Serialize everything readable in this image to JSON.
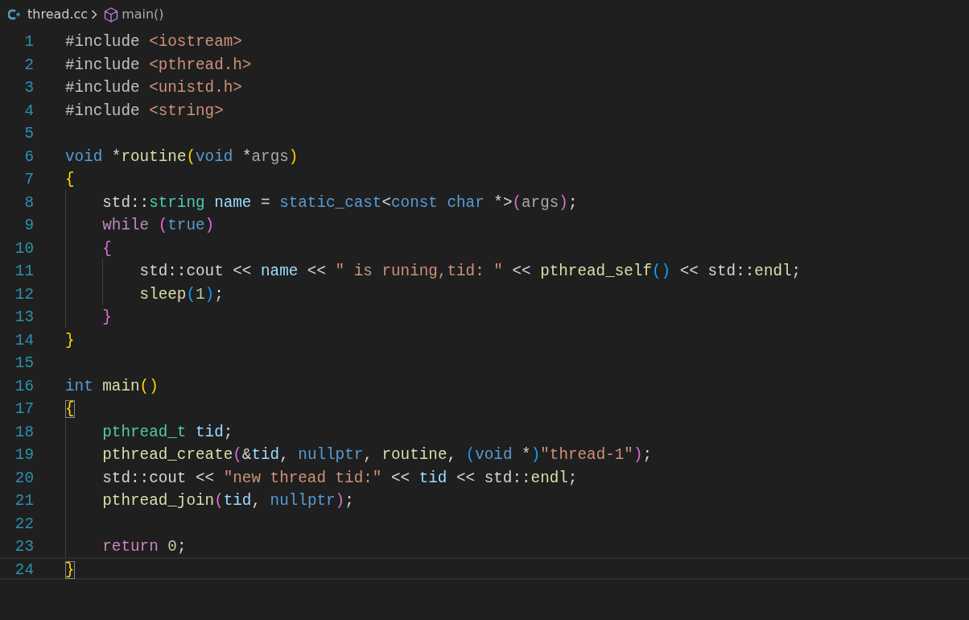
{
  "breadcrumb": {
    "file": "thread.cc",
    "symbol": "main()"
  },
  "lines": [
    {
      "number": "1",
      "tokens": [
        {
          "text": "#include ",
          "kind": "directive"
        },
        {
          "text": "<iostream>",
          "kind": "string"
        }
      ]
    },
    {
      "number": "2",
      "tokens": [
        {
          "text": "#include ",
          "kind": "directive"
        },
        {
          "text": "<pthread.h>",
          "kind": "string"
        }
      ]
    },
    {
      "number": "3",
      "tokens": [
        {
          "text": "#include ",
          "kind": "directive"
        },
        {
          "text": "<unistd.h>",
          "kind": "string"
        }
      ]
    },
    {
      "number": "4",
      "tokens": [
        {
          "text": "#include ",
          "kind": "directive"
        },
        {
          "text": "<string>",
          "kind": "string"
        }
      ]
    },
    {
      "number": "5"
    },
    {
      "number": "6",
      "tokens": [
        {
          "text": "void",
          "kind": "keyword"
        },
        {
          "text": " *",
          "kind": "plain"
        },
        {
          "text": "routine",
          "kind": "function"
        },
        {
          "text": "(",
          "kind": "bracket1"
        },
        {
          "text": "void",
          "kind": "keyword"
        },
        {
          "text": " *",
          "kind": "plain"
        },
        {
          "text": "args",
          "kind": "param"
        },
        {
          "text": ")",
          "kind": "bracket1"
        }
      ]
    },
    {
      "number": "7",
      "tokens": [
        {
          "text": "{",
          "kind": "bracket1"
        }
      ]
    },
    {
      "number": "8",
      "tokens": [
        {
          "text": "    std::",
          "kind": "plain"
        },
        {
          "text": "string",
          "kind": "type"
        },
        {
          "text": " name",
          "kind": "variable"
        },
        {
          "text": " = ",
          "kind": "plain"
        },
        {
          "text": "static_cast",
          "kind": "keyword"
        },
        {
          "text": "<",
          "kind": "plain"
        },
        {
          "text": "const char",
          "kind": "keyword"
        },
        {
          "text": " *>",
          "kind": "plain"
        },
        {
          "text": "(",
          "kind": "bracket2"
        },
        {
          "text": "args",
          "kind": "param"
        },
        {
          "text": ")",
          "kind": "bracket2"
        },
        {
          "text": ";",
          "kind": "plain"
        }
      ]
    },
    {
      "number": "9",
      "tokens": [
        {
          "text": "    while",
          "kind": "control"
        },
        {
          "text": " (",
          "kind": "bracket2"
        },
        {
          "text": "true",
          "kind": "keyword"
        },
        {
          "text": ")",
          "kind": "bracket2"
        }
      ]
    },
    {
      "number": "10",
      "tokens": [
        {
          "text": "    {",
          "kind": "bracket2"
        }
      ]
    },
    {
      "number": "11",
      "tokens": [
        {
          "text": "        std::cout << ",
          "kind": "plain"
        },
        {
          "text": "name",
          "kind": "variable"
        },
        {
          "text": " << ",
          "kind": "plain"
        },
        {
          "text": "\" is runing,tid: \"",
          "kind": "string"
        },
        {
          "text": " << ",
          "kind": "plain"
        },
        {
          "text": "pthread_self",
          "kind": "function"
        },
        {
          "text": "()",
          "kind": "bracket3"
        },
        {
          "text": " << std::",
          "kind": "plain"
        },
        {
          "text": "endl",
          "kind": "function"
        },
        {
          "text": ";",
          "kind": "plain"
        }
      ]
    },
    {
      "number": "12",
      "tokens": [
        {
          "text": "        sleep",
          "kind": "function"
        },
        {
          "text": "(",
          "kind": "bracket3"
        },
        {
          "text": "1",
          "kind": "number"
        },
        {
          "text": ")",
          "kind": "bracket3"
        },
        {
          "text": ";",
          "kind": "plain"
        }
      ]
    },
    {
      "number": "13",
      "tokens": [
        {
          "text": "    }",
          "kind": "bracket2"
        }
      ]
    },
    {
      "number": "14",
      "tokens": [
        {
          "text": "}",
          "kind": "bracket1"
        }
      ]
    },
    {
      "number": "15"
    },
    {
      "number": "16",
      "tokens": [
        {
          "text": "int",
          "kind": "keyword"
        },
        {
          "text": " main",
          "kind": "function"
        },
        {
          "text": "()",
          "kind": "bracket1"
        }
      ]
    },
    {
      "number": "17",
      "tokens": [
        {
          "text": "{",
          "kind": "bracket1",
          "matched": true
        }
      ]
    },
    {
      "number": "18",
      "tokens": [
        {
          "text": "    pthread_t",
          "kind": "type"
        },
        {
          "text": " tid",
          "kind": "variable"
        },
        {
          "text": ";",
          "kind": "plain"
        }
      ]
    },
    {
      "number": "19",
      "tokens": [
        {
          "text": "    pthread_create",
          "kind": "function"
        },
        {
          "text": "(",
          "kind": "bracket2"
        },
        {
          "text": "&",
          "kind": "plain"
        },
        {
          "text": "tid",
          "kind": "variable"
        },
        {
          "text": ", ",
          "kind": "plain"
        },
        {
          "text": "nullptr",
          "kind": "keyword"
        },
        {
          "text": ", ",
          "kind": "plain"
        },
        {
          "text": "routine",
          "kind": "function"
        },
        {
          "text": ", ",
          "kind": "plain"
        },
        {
          "text": "(",
          "kind": "bracket3"
        },
        {
          "text": "void",
          "kind": "keyword"
        },
        {
          "text": " *",
          "kind": "plain"
        },
        {
          "text": ")",
          "kind": "bracket3"
        },
        {
          "text": "\"thread-1\"",
          "kind": "string"
        },
        {
          "text": ")",
          "kind": "bracket2"
        },
        {
          "text": ";",
          "kind": "plain"
        }
      ]
    },
    {
      "number": "20",
      "tokens": [
        {
          "text": "    std::cout << ",
          "kind": "plain"
        },
        {
          "text": "\"new thread tid:\"",
          "kind": "string"
        },
        {
          "text": " << ",
          "kind": "plain"
        },
        {
          "text": "tid",
          "kind": "variable"
        },
        {
          "text": " << std::",
          "kind": "plain"
        },
        {
          "text": "endl",
          "kind": "function"
        },
        {
          "text": ";",
          "kind": "plain"
        }
      ]
    },
    {
      "number": "21",
      "tokens": [
        {
          "text": "    pthread_join",
          "kind": "function"
        },
        {
          "text": "(",
          "kind": "bracket2"
        },
        {
          "text": "tid",
          "kind": "variable"
        },
        {
          "text": ", ",
          "kind": "plain"
        },
        {
          "text": "nullptr",
          "kind": "keyword"
        },
        {
          "text": ")",
          "kind": "bracket2"
        },
        {
          "text": ";",
          "kind": "plain"
        }
      ]
    },
    {
      "number": "22"
    },
    {
      "number": "23",
      "tokens": [
        {
          "text": "    return",
          "kind": "control"
        },
        {
          "text": " 0",
          "kind": "number"
        },
        {
          "text": ";",
          "kind": "plain"
        }
      ]
    },
    {
      "number": "24",
      "current": true,
      "tokens": [
        {
          "text": "}",
          "kind": "bracket1",
          "matched": true
        }
      ]
    }
  ]
}
